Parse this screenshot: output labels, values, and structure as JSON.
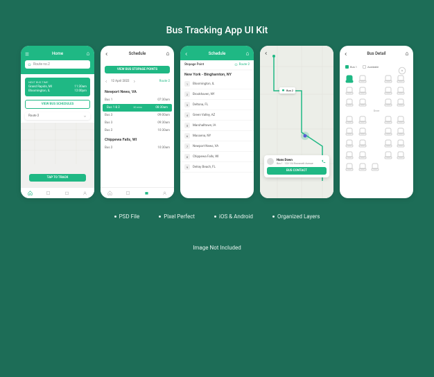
{
  "title": "Bus Tracking App UI Kit",
  "features": [
    "PSD File",
    "Pixel Perfect",
    "iOS & Android",
    "Organized Layers"
  ],
  "footer": "Image Not Included",
  "s1": {
    "header": "Home",
    "search": "Route no.2",
    "card_label": "NEXT BUS TIME",
    "r1_a": "Grand Rapids, MI",
    "r1_b": "11:30am",
    "r2_a": "Bloomington, IL",
    "r2_b": "12:00pm",
    "btn1": "VIEW BUS SCHEDULES",
    "drop": "Route 2",
    "btn2": "TAP TO TRACK"
  },
  "s2": {
    "header": "Schedule",
    "btn": "VIEW BUS STOPAGE POINTS",
    "date": "12 April 2022",
    "route": "Route 2",
    "g1": "Newport News, VA",
    "rows": [
      {
        "a": "Bus 1",
        "b": "07:30am"
      },
      {
        "a": "Bus 1 & 2",
        "b": "08:30am",
        "hl": true,
        "m": "30 mins"
      },
      {
        "a": "Bus 3",
        "b": "09:00am"
      },
      {
        "a": "Bus 3",
        "b": "09:30am"
      },
      {
        "a": "Bus 2",
        "b": "10:30am"
      }
    ],
    "g2": "Chippewa Falls, WI",
    "rows2": [
      {
        "a": "Bus 2",
        "b": "10:30am"
      }
    ]
  },
  "s3": {
    "header": "Schedule",
    "stoppage": "Stopage Point",
    "route": "Route 2",
    "title": "New York - Binghamton, NY",
    "stops": [
      "Bloomington, IL",
      "Brookhaven, NY",
      "Deltona, FL",
      "Green Valley, AZ",
      "Marshalltown, IA",
      "Massena, NY",
      "Newport News, VA",
      "Chippewa Falls, WI",
      "Delray Beach, FL"
    ]
  },
  "s4": {
    "bus1": "Bus 1",
    "bus2": "Bus 2",
    "name": "Hans Down",
    "sub": "Bus 1 · 123-124 Roosevelt Avenue",
    "btn": "BUS CONTACT"
  },
  "s5": {
    "header": "Bus Detail",
    "bus": "Bus 1",
    "avail": "Available",
    "door": "Door"
  }
}
